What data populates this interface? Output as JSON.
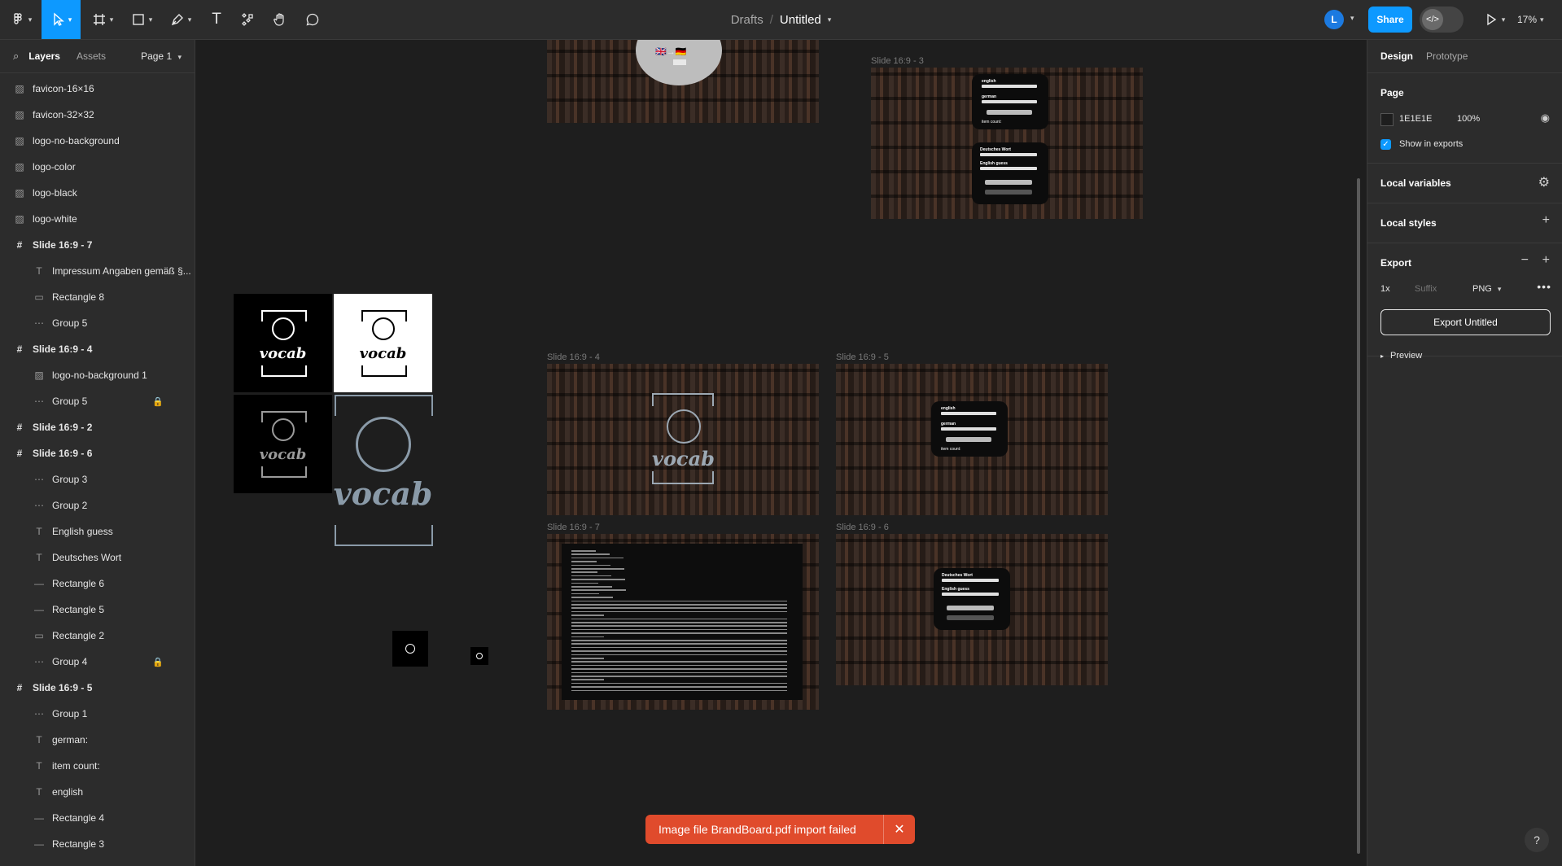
{
  "toolbar": {
    "menu_icon": "figma-logo-icon",
    "tools": [
      "move-tool",
      "frame-tool",
      "shape-tool",
      "pen-tool",
      "text-tool",
      "components-tool",
      "hand-tool",
      "comment-tool"
    ],
    "text_tool_glyph": "T"
  },
  "breadcrumb": {
    "folder": "Drafts",
    "separator": "/",
    "file": "Untitled"
  },
  "user": {
    "initial": "L"
  },
  "share_label": "Share",
  "zoom_label": "17%",
  "left_panel": {
    "tabs": [
      "Layers",
      "Assets"
    ],
    "page": "Page 1",
    "layers": [
      {
        "name": "favicon-16×16",
        "kind": "image",
        "indent": 0
      },
      {
        "name": "favicon-32×32",
        "kind": "image",
        "indent": 0
      },
      {
        "name": "logo-no-background",
        "kind": "image",
        "indent": 0
      },
      {
        "name": "logo-color",
        "kind": "image",
        "indent": 0
      },
      {
        "name": "logo-black",
        "kind": "image",
        "indent": 0
      },
      {
        "name": "logo-white",
        "kind": "image",
        "indent": 0
      },
      {
        "name": "Slide 16:9 - 7",
        "kind": "frame",
        "indent": 0
      },
      {
        "name": "Impressum Angaben gemäß §...",
        "kind": "text",
        "indent": 1
      },
      {
        "name": "Rectangle 8",
        "kind": "rect",
        "indent": 1
      },
      {
        "name": "Group 5",
        "kind": "group",
        "indent": 1
      },
      {
        "name": "Slide 16:9 - 4",
        "kind": "frame",
        "indent": 0
      },
      {
        "name": "logo-no-background 1",
        "kind": "image",
        "indent": 1
      },
      {
        "name": "Group 5",
        "kind": "group",
        "indent": 1,
        "locked": true
      },
      {
        "name": "Slide 16:9 - 2",
        "kind": "frame",
        "indent": 0
      },
      {
        "name": "Slide 16:9 - 6",
        "kind": "frame",
        "indent": 0
      },
      {
        "name": "Group 3",
        "kind": "group",
        "indent": 1
      },
      {
        "name": "Group 2",
        "kind": "group",
        "indent": 1
      },
      {
        "name": "English guess",
        "kind": "text",
        "indent": 1
      },
      {
        "name": "Deutsches Wort",
        "kind": "text",
        "indent": 1
      },
      {
        "name": "Rectangle 6",
        "kind": "line",
        "indent": 1
      },
      {
        "name": "Rectangle 5",
        "kind": "line",
        "indent": 1
      },
      {
        "name": "Rectangle 2",
        "kind": "rect",
        "indent": 1
      },
      {
        "name": "Group 4",
        "kind": "group",
        "indent": 1,
        "locked": true
      },
      {
        "name": "Slide 16:9 - 5",
        "kind": "frame",
        "indent": 0
      },
      {
        "name": "Group 1",
        "kind": "group",
        "indent": 1
      },
      {
        "name": "german:",
        "kind": "text",
        "indent": 1
      },
      {
        "name": "item count:",
        "kind": "text",
        "indent": 1
      },
      {
        "name": "english",
        "kind": "text",
        "indent": 1
      },
      {
        "name": "Rectangle 4",
        "kind": "line",
        "indent": 1
      },
      {
        "name": "Rectangle 3",
        "kind": "line",
        "indent": 1
      }
    ]
  },
  "canvas": {
    "frames": {
      "s3": "Slide 16:9 - 3",
      "s4": "Slide 16:9 - 4",
      "s5": "Slide 16:9 - 5",
      "s7": "Slide 16:9 - 7",
      "s6": "Slide 16:9 - 6"
    },
    "logo_word": "vocab",
    "slide3_card1": {
      "a": "english",
      "b": "german",
      "c": "item count:"
    },
    "slide3_card2": {
      "a": "Deutsches Wort",
      "b": "English guess"
    },
    "slide5_card": {
      "a": "english",
      "b": "german",
      "c": "item count:"
    },
    "slide6_card": {
      "a": "Deutsches Wort",
      "b": "English guess"
    }
  },
  "right_panel": {
    "tabs": [
      "Design",
      "Prototype"
    ],
    "page_title": "Page",
    "page_color": "1E1E1E",
    "page_opacity": "100%",
    "show_in_exports": "Show in exports",
    "local_variables": "Local variables",
    "local_styles": "Local styles",
    "export_title": "Export",
    "export_scale": "1x",
    "export_suffix_placeholder": "Suffix",
    "export_format": "PNG",
    "export_button": "Export Untitled",
    "preview": "Preview"
  },
  "toast": {
    "message": "Image file BrandBoard.pdf import failed",
    "color": "#e04b2c"
  },
  "colors": {
    "accent": "#0d99ff",
    "panel": "#2c2c2c",
    "canvas": "#1e1e1e"
  },
  "help": "?"
}
